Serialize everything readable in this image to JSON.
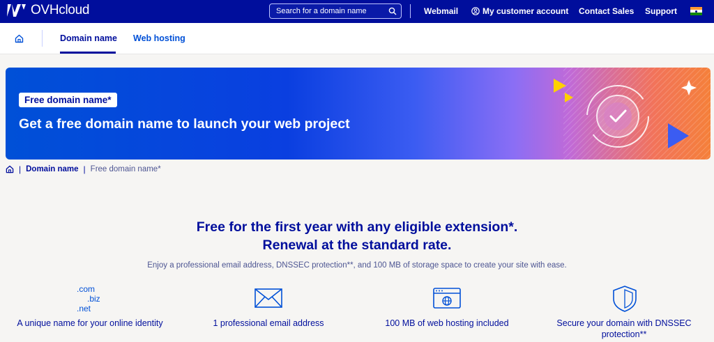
{
  "header": {
    "logo_text": "OVHcloud",
    "search_placeholder": "Search for a domain name",
    "links": {
      "webmail": "Webmail",
      "account": "My customer account",
      "contact": "Contact Sales",
      "support": "Support"
    },
    "flag_icon": "india-flag-icon"
  },
  "subnav": {
    "tabs": [
      {
        "label": "Domain name",
        "active": true
      },
      {
        "label": "Web hosting",
        "active": false
      }
    ]
  },
  "banner": {
    "badge": "Free domain name*",
    "title": "Get a free domain name to launch your web project"
  },
  "breadcrumb": {
    "items": [
      "Domain name",
      "Free domain name*"
    ]
  },
  "main": {
    "headline_line1": "Free for the first year with any eligible extension*.",
    "headline_line2": "Renewal at the standard rate.",
    "subline": "Enjoy a professional email address, DNSSEC protection**, and 100 MB of storage space to create your site with ease.",
    "features": [
      {
        "icon": "domain-extensions-icon",
        "label": "A unique name for your online identity",
        "extensions": [
          ".com",
          ".biz",
          ".net"
        ]
      },
      {
        "icon": "envelope-icon",
        "label": "1 professional email address"
      },
      {
        "icon": "browser-globe-icon",
        "label": "100 MB of web hosting included"
      },
      {
        "icon": "shield-check-icon",
        "label": "Secure your domain with DNSSEC protection**"
      }
    ]
  },
  "colors": {
    "brand": "#000e9c",
    "link": "#0050d7",
    "background": "#f6f5f3"
  }
}
